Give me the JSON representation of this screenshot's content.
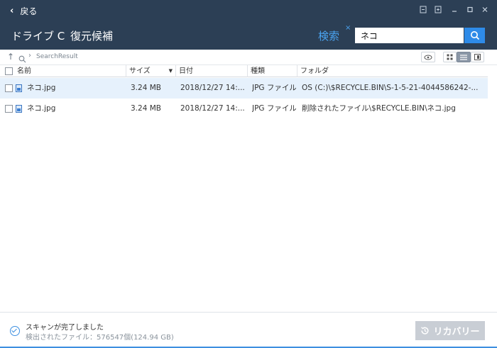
{
  "titlebar": {
    "back_label": "戻る"
  },
  "header": {
    "tabs": [
      "ドライブ C",
      "復元候補"
    ],
    "search_tab_label": "検索",
    "search_close": "×",
    "search_value": "ネコ"
  },
  "pathbar": {
    "path": "SearchResult"
  },
  "table": {
    "columns": [
      "名前",
      "サイズ",
      "日付",
      "種類",
      "フォルダ"
    ],
    "rows": [
      {
        "name": "ネコ.jpg",
        "size": "3.24 MB",
        "date": "2018/12/27 14:...",
        "type": "JPG ファイル",
        "folder": "OS (C:)\\$RECYCLE.BIN\\S-1-5-21-4044586242-...",
        "selected": true
      },
      {
        "name": "ネコ.jpg",
        "size": "3.24 MB",
        "date": "2018/12/27 14:...",
        "type": "JPG ファイル",
        "folder": "削除されたファイル\\$RECYCLE.BIN\\ネコ.jpg",
        "selected": false
      }
    ]
  },
  "footer": {
    "status_title": "スキャンが完了しました",
    "status_detail": "検出されたファイル：576547個(124.94 GB)",
    "recover_label": "リカバリー"
  },
  "colors": {
    "header_bg": "#2c3f55",
    "accent": "#2e8be8",
    "search_tab": "#4aa3f0",
    "selected_row": "#e6f1fc",
    "disabled_button": "#c9ced5"
  },
  "icons": [
    "back-chevron-icon",
    "minimize-to-tray-icon",
    "login-icon",
    "minimize-icon",
    "maximize-icon",
    "close-icon",
    "search-icon",
    "up-arrow-icon",
    "eye-icon",
    "grid-view-icon",
    "list-view-icon",
    "preview-pane-icon",
    "image-file-icon",
    "check-circle-icon",
    "restore-icon"
  ]
}
